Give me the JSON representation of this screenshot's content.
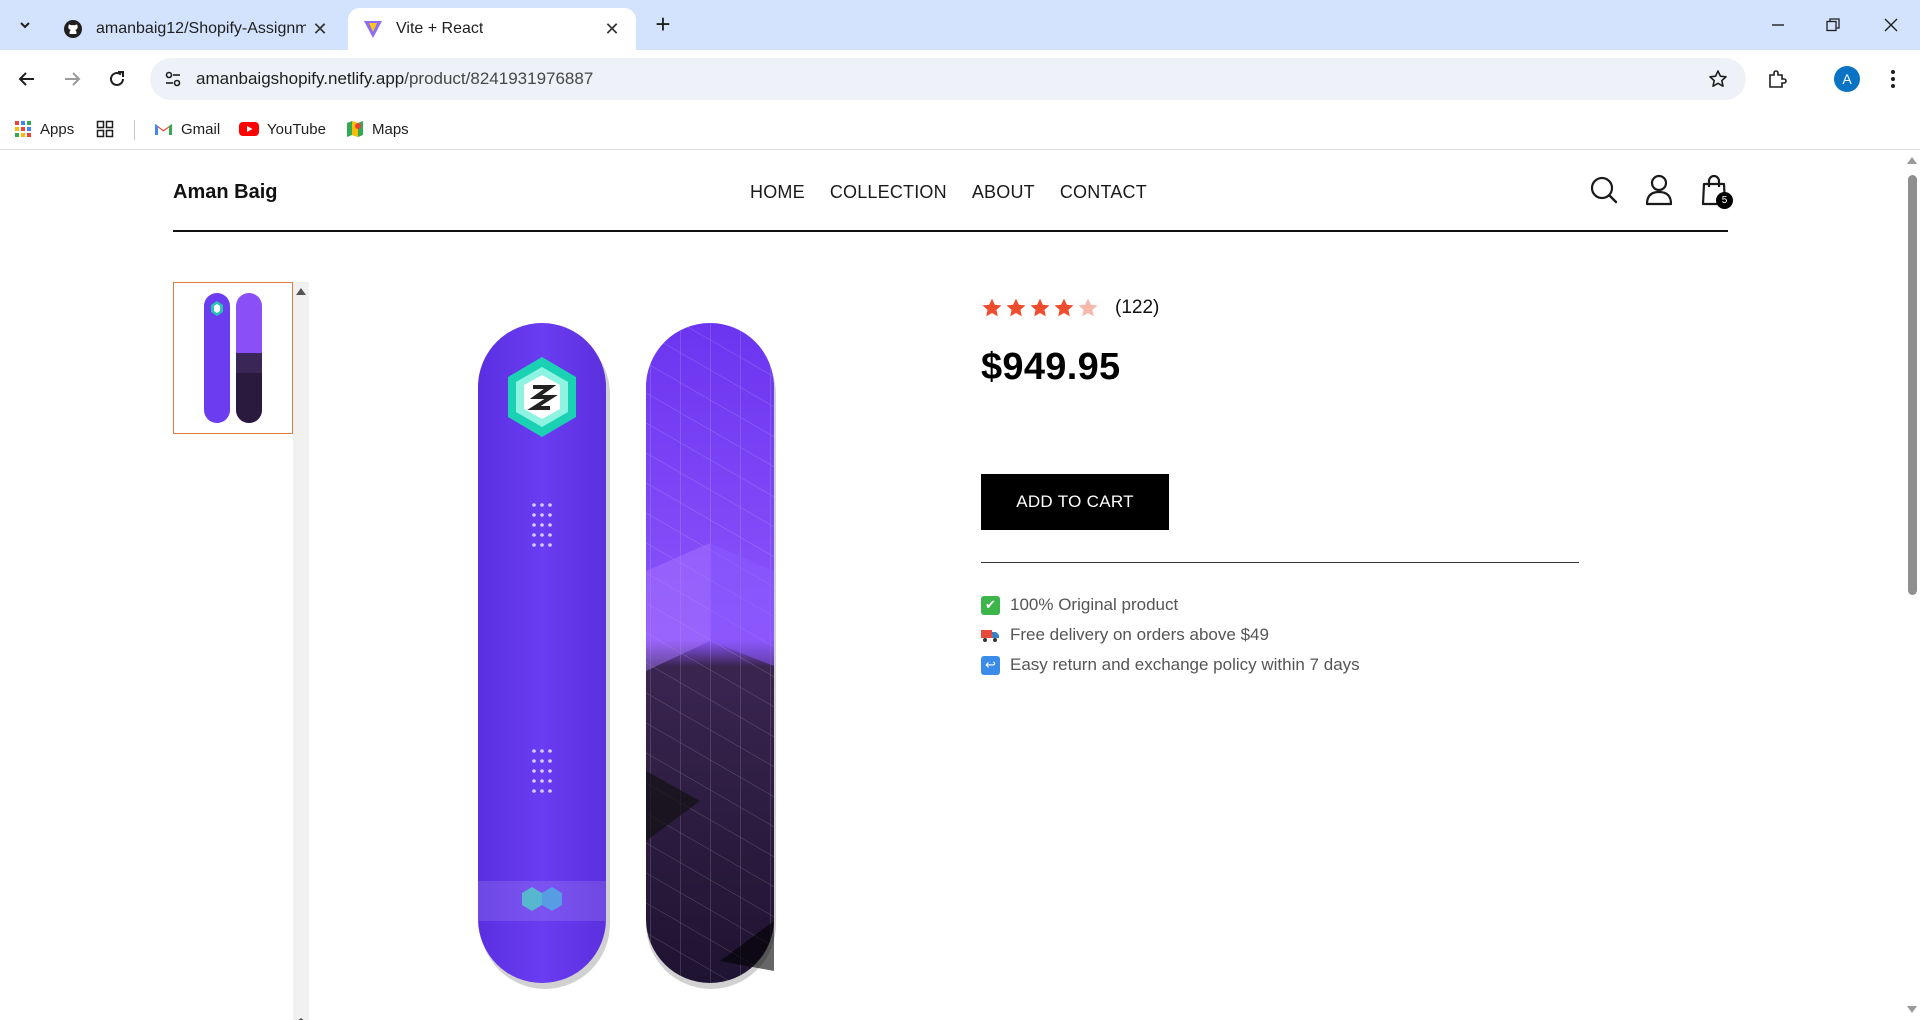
{
  "browser": {
    "tabs": [
      {
        "title": "amanbaig12/Shopify-Assignme",
        "icon": "github-icon",
        "active": false
      },
      {
        "title": "Vite + React",
        "icon": "vite-icon",
        "active": true
      }
    ],
    "url_host": "amanbaigshopify.netlify.app",
    "url_path": "/product/8241931976887",
    "profile_initial": "A",
    "bookmarks": [
      {
        "label": "Apps",
        "icon": "apps-grid-icon"
      },
      {
        "label": "Gmail",
        "icon": "gmail-icon"
      },
      {
        "label": "YouTube",
        "icon": "youtube-icon"
      },
      {
        "label": "Maps",
        "icon": "maps-icon"
      }
    ]
  },
  "site": {
    "brand": "Aman Baig",
    "nav": [
      "HOME",
      "COLLECTION",
      "ABOUT",
      "CONTACT"
    ],
    "cart_count": "5"
  },
  "product": {
    "rating": 4,
    "rating_max": 5,
    "review_count": "(122)",
    "price": "$949.95",
    "add_to_cart_label": "ADD TO CART",
    "perks": [
      {
        "icon": "check-icon",
        "text": "100% Original product"
      },
      {
        "icon": "truck-icon",
        "text": "Free delivery on orders above $49"
      },
      {
        "icon": "return-icon",
        "text": "Easy return and exchange policy within 7 days"
      }
    ]
  },
  "colors": {
    "accent_star": "#ee4d2d",
    "board_purple": "#6b3cf0",
    "thumb_border": "#e07b39"
  }
}
